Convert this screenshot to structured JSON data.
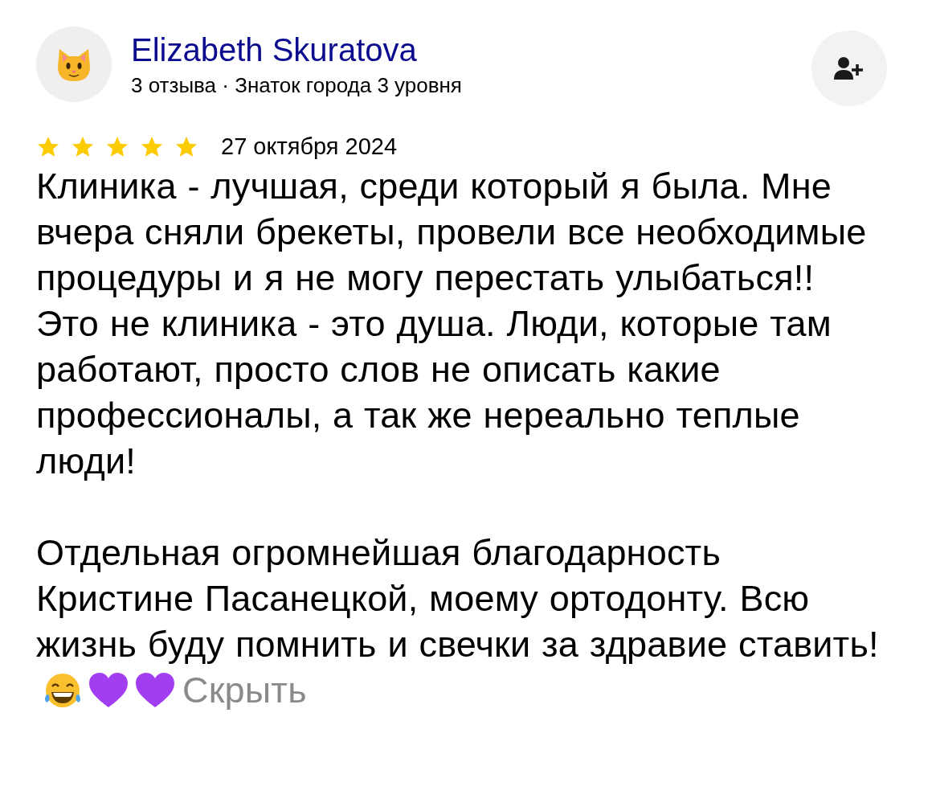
{
  "author": {
    "name": "Elizabeth Skuratova",
    "subtitle": "3 отзыва · Знаток города 3 уровня"
  },
  "review": {
    "stars": 5,
    "date": "27 октября 2024",
    "paragraphs": [
      "Клиника - лучшая, среди который я была. Мне вчера сняли брекеты, провели все необходимые процедуры и я не могу перестать улыбаться!! Это не клиника - это душа. Люди, которые там работают, просто слов не описать какие профессионалы, а так же нереально теплые люди!",
      "Отдельная огромнейшая благодарность Кристине Пасанецкой, моему ортодонту. Всю жизнь буду помнить и свечки за здравие ставить!"
    ],
    "emojis": [
      {
        "kind": "laughing"
      },
      {
        "kind": "heart"
      },
      {
        "kind": "heart"
      }
    ],
    "hide_link": "Скрыть"
  }
}
